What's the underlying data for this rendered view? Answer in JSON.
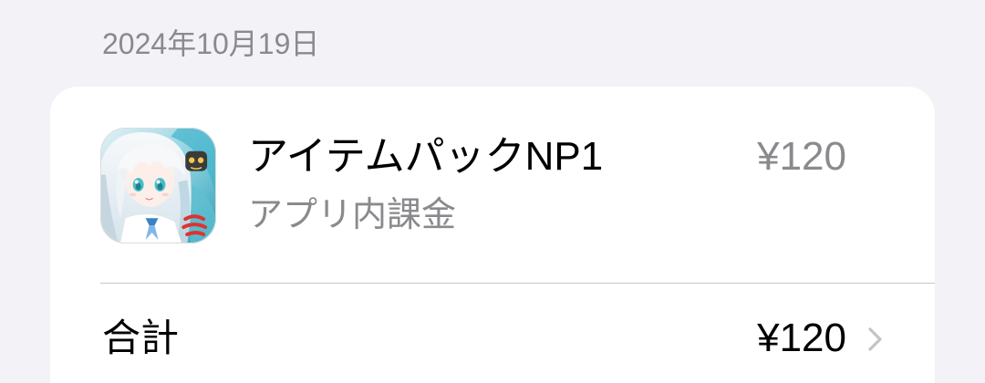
{
  "date_header": "2024年10月19日",
  "purchase": {
    "app_icon": "app-icon",
    "item_title": "アイテムパックNP1",
    "item_type": "アプリ内課金",
    "price": "¥120"
  },
  "total": {
    "label": "合計",
    "amount": "¥120",
    "chevron_icon": "chevron-right-icon"
  },
  "colors": {
    "background": "#f2f2f7",
    "card": "#ffffff",
    "primary_text": "#000000",
    "secondary_text": "#8a8a8e",
    "separator": "#c6c6c8",
    "chevron": "#c4c4c7"
  }
}
